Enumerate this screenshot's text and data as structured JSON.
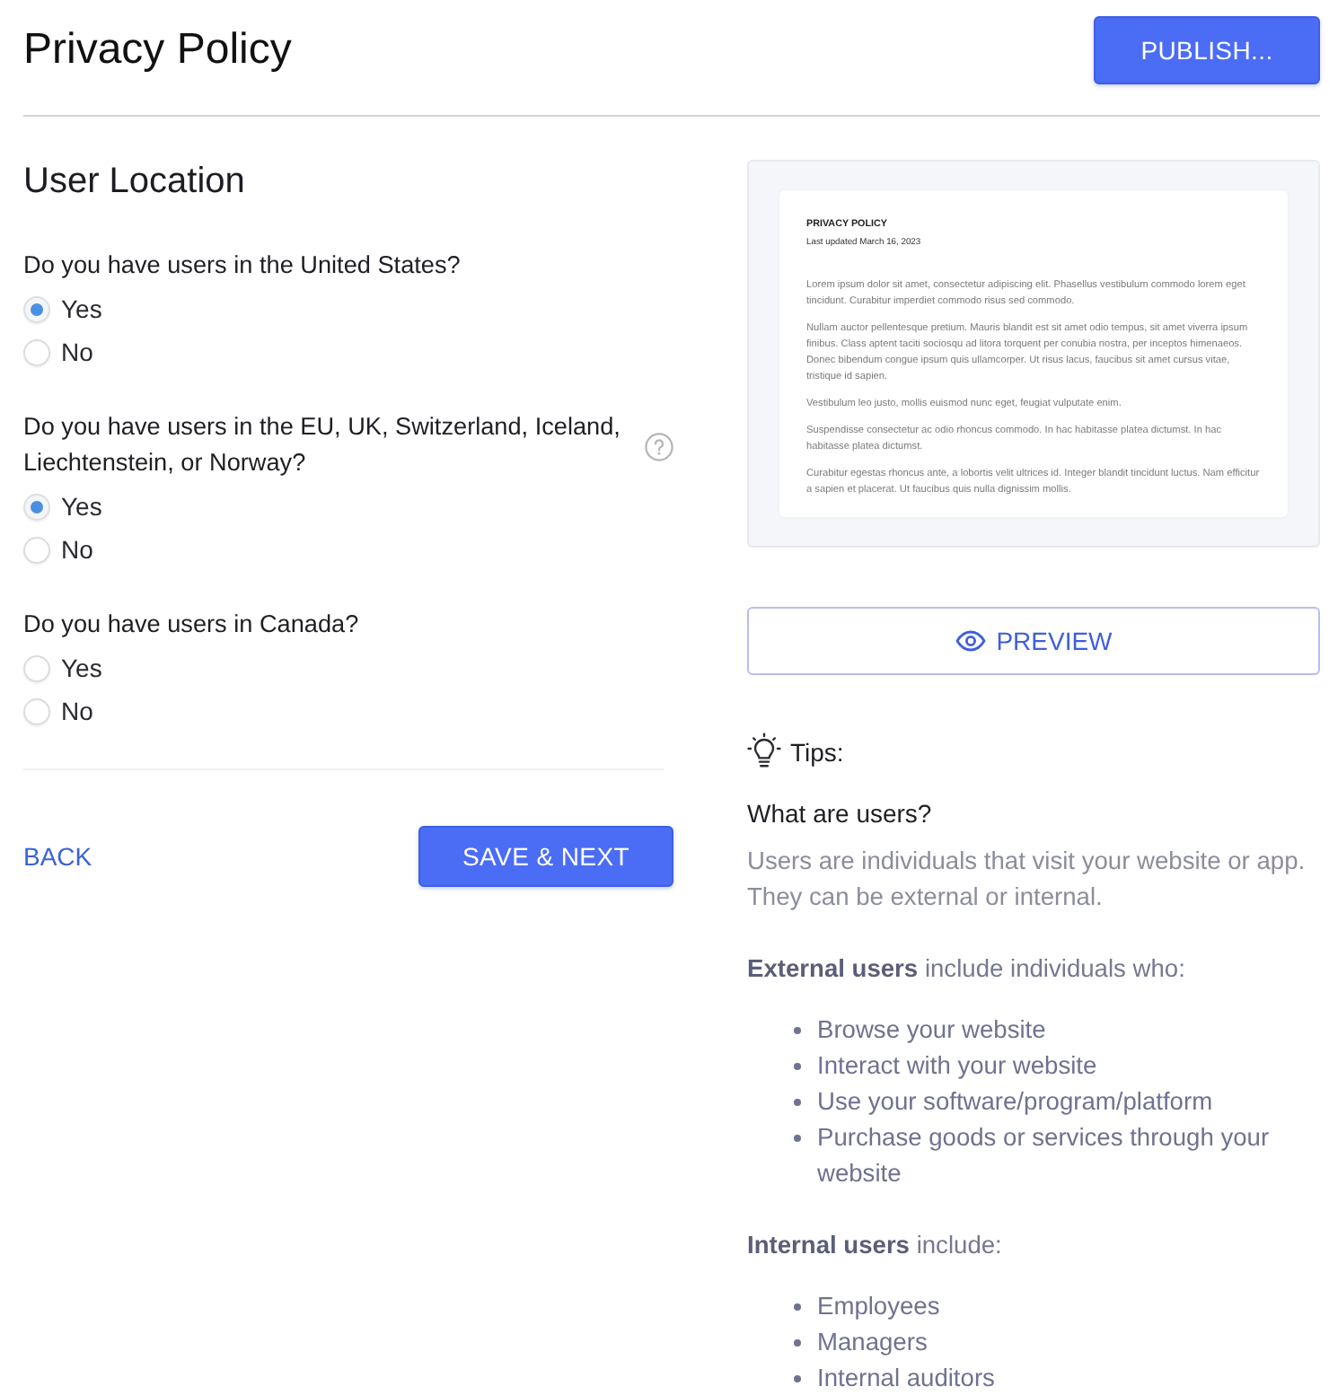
{
  "header": {
    "title": "Privacy Policy",
    "publish_button": "PUBLISH..."
  },
  "form": {
    "section_title": "User Location",
    "questions": [
      {
        "kind": "plain",
        "text": "Do you have users in the United States?",
        "options": [
          {
            "label": "Yes",
            "selected": true
          },
          {
            "label": "No",
            "selected": false
          }
        ]
      },
      {
        "kind": "with_help",
        "text": "Do you have users in the EU, UK, Switzerland, Iceland, Liechtenstein, or Norway?",
        "options": [
          {
            "label": "Yes",
            "selected": true
          },
          {
            "label": "No",
            "selected": false
          }
        ]
      },
      {
        "kind": "plain",
        "text": "Do you have users in Canada?",
        "options": [
          {
            "label": "Yes",
            "selected": false
          },
          {
            "label": "No",
            "selected": false
          }
        ]
      }
    ],
    "back_link": "BACK",
    "save_button": "SAVE & NEXT"
  },
  "preview": {
    "document": {
      "title": "PRIVACY POLICY",
      "updated": "Last updated March 16, 2023",
      "paragraphs": [
        "Lorem ipsum dolor sit amet, consectetur adipiscing elit. Phasellus vestibulum commodo lorem eget tincidunt. Curabitur imperdiet commodo risus sed commodo.",
        "Nullam auctor pellentesque pretium. Mauris blandit est sit amet odio tempus, sit amet viverra ipsum finibus. Class aptent taciti sociosqu ad litora torquent per conubia nostra, per inceptos himenaeos. Donec bibendum congue ipsum quis ullamcorper. Ut risus lacus, faucibus sit amet cursus vitae, tristique id sapien.",
        "Vestibulum leo justo, mollis euismod nunc eget, feugiat vulputate enim.",
        "Suspendisse consectetur ac odio rhoncus commodo. In hac habitasse platea dictumst. In hac habitasse platea dictumst.",
        "Curabitur egestas rhoncus ante, a lobortis velit ultrices id. Integer blandit tincidunt luctus. Nam efficitur a sapien et placerat. Ut faucibus quis nulla dignissim mollis."
      ]
    },
    "preview_button": "PREVIEW"
  },
  "tips": {
    "label": "Tips:",
    "heading": "What are users?",
    "intro": "Users are individuals that visit your website or app. They can be external or internal.",
    "sections": [
      {
        "lead": "**External users** include individuals who:",
        "items": [
          "Browse your website",
          "Interact with your website",
          "Use your software/program/platform",
          "Purchase goods or services through your website"
        ]
      },
      {
        "lead": "**Internal users** include:",
        "items": [
          "Employees",
          "Managers",
          "Internal auditors"
        ]
      }
    ]
  }
}
